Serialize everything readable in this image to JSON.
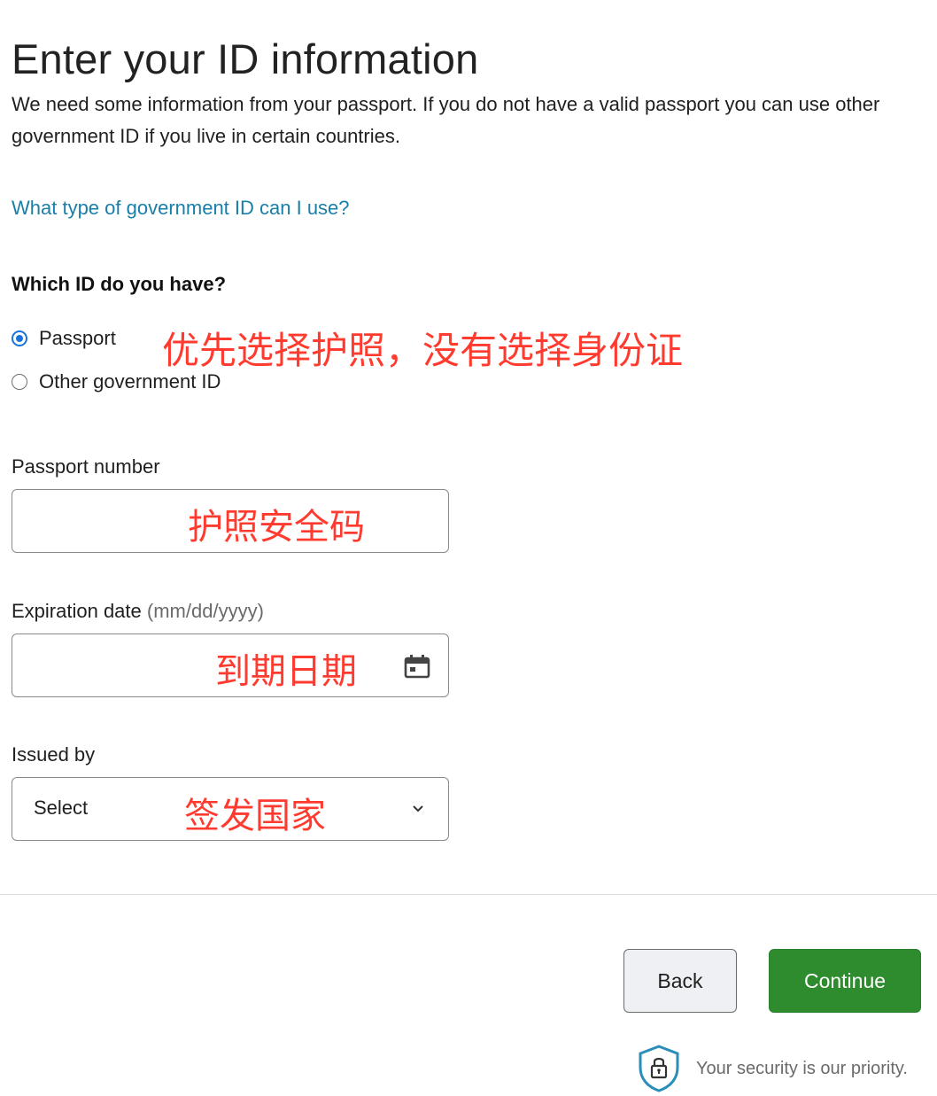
{
  "page": {
    "title": "Enter your ID information",
    "intro": "We need some information from your passport. If you do not have a valid passport you can use other government ID if you live in certain countries.",
    "help_link": "What type of government ID can I use?"
  },
  "id_type": {
    "question": "Which ID do you have?",
    "options": [
      {
        "label": "Passport",
        "checked": true
      },
      {
        "label": "Other government ID",
        "checked": false
      }
    ],
    "annotation": "优先选择护照，没有选择身份证"
  },
  "passport_number": {
    "label": "Passport number",
    "value": "",
    "annotation": "护照安全码"
  },
  "expiration_date": {
    "label": "Expiration date",
    "hint": "(mm/dd/yyyy)",
    "value": "",
    "annotation": "到期日期",
    "icon": "calendar-icon"
  },
  "issued_by": {
    "label": "Issued by",
    "selected": "Select",
    "annotation": "签发国家",
    "icon": "chevron-down-icon"
  },
  "actions": {
    "back_label": "Back",
    "continue_label": "Continue"
  },
  "security": {
    "text": "Your security is our priority.",
    "icon": "shield-lock-icon"
  },
  "colors": {
    "link": "#1a7fa8",
    "annotation": "#ff3b30",
    "continue_button": "#2e8b2e",
    "radio_selected": "#1a73d9"
  }
}
